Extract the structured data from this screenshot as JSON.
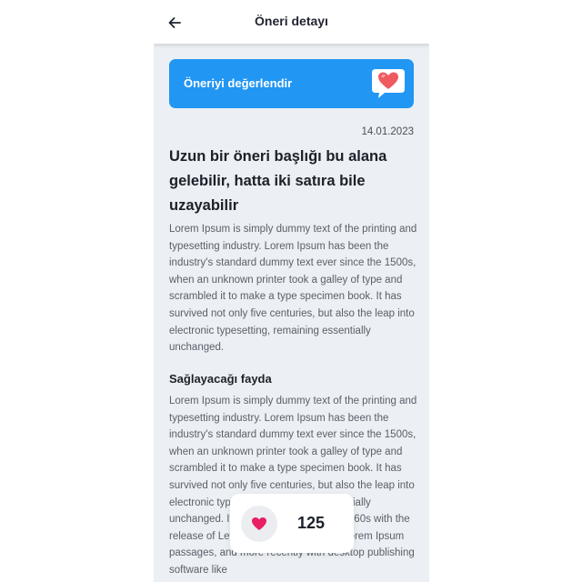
{
  "appbar": {
    "title": "Öneri detayı",
    "back_icon": "arrow-left-icon"
  },
  "rate_banner": {
    "label": "Öneriyi değerlendir",
    "icon": "heart-speech-bubble-icon"
  },
  "date": "14.01.2023",
  "title": "Uzun bir öneri başlığı bu alana gelebilir, hatta iki satıra bile uzayabilir",
  "description": "Lorem Ipsum is simply dummy text of the printing and typesetting industry. Lorem Ipsum has been the industry's standard dummy text ever since the 1500s, when an unknown printer took a galley of type and scrambled it to make a type specimen book. It has survived not only five centuries, but also the leap into electronic typesetting, remaining essentially unchanged.",
  "benefit": {
    "heading": "Sağlayacağı fayda",
    "text": "Lorem Ipsum is simply dummy text of the printing and typesetting industry. Lorem Ipsum has been the industry's standard dummy text ever since the 1500s, when an unknown printer took a galley of type and scrambled it to make a type specimen book. It has survived not only five centuries, but also the leap into electronic typesetting, remaining essentially unchanged. It was popularised in the 1960s with the release of Letraset sheets containing Lorem Ipsum passages, and more recently with desktop publishing software like"
  },
  "likes": {
    "count": "125",
    "icon": "heart-icon"
  },
  "colors": {
    "primary": "#2196f3",
    "heart": "#e91e63",
    "background": "#eceff3"
  }
}
